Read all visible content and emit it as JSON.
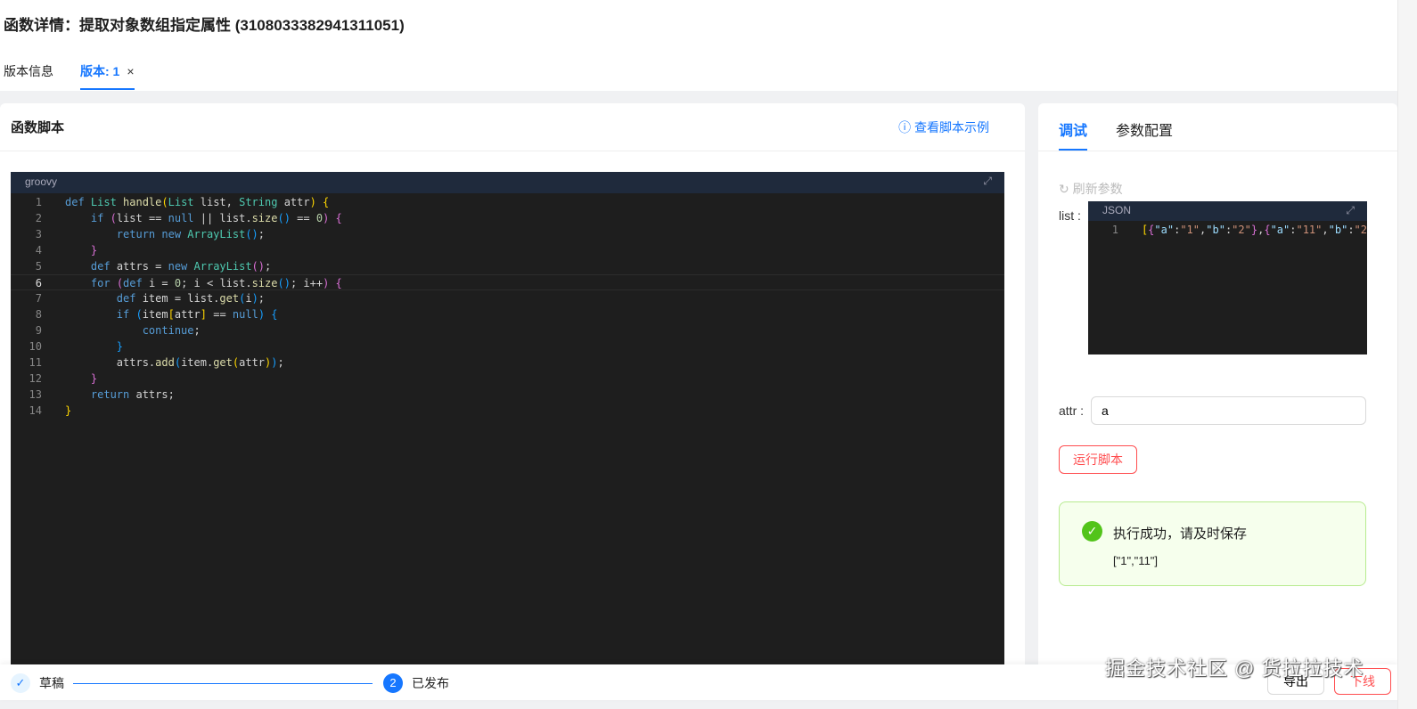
{
  "header": {
    "title": "函数详情：提取对象数组指定属性 (3108033382941311051)",
    "tabs": [
      "版本信息",
      "版本: 1"
    ],
    "close_icon": "×"
  },
  "script_panel": {
    "title": "函数脚本",
    "example_link": "查看脚本示例",
    "language": "groovy",
    "expand_icon": "⤢",
    "code": [
      [
        [
          "kw",
          "def "
        ],
        [
          "ty",
          "List "
        ],
        [
          "fn",
          "handle"
        ],
        [
          "p1",
          "("
        ],
        [
          "ty",
          "List "
        ],
        [
          "",
          "list, "
        ],
        [
          "ty",
          "String "
        ],
        [
          "",
          "attr"
        ],
        [
          "p1",
          ") {"
        ]
      ],
      [
        [
          "",
          "    "
        ],
        [
          "kw",
          "if "
        ],
        [
          "p2",
          "("
        ],
        [
          "",
          "list == "
        ],
        [
          "kw",
          "null"
        ],
        [
          "",
          " || list."
        ],
        [
          "fn",
          "size"
        ],
        [
          "p3",
          "()"
        ],
        [
          "",
          " == "
        ],
        [
          "num",
          "0"
        ],
        [
          "p2",
          ") {"
        ]
      ],
      [
        [
          "",
          "        "
        ],
        [
          "kw",
          "return new "
        ],
        [
          "ty",
          "ArrayList"
        ],
        [
          "p3",
          "()"
        ],
        [
          "",
          ";"
        ]
      ],
      [
        [
          "",
          "    "
        ],
        [
          "p2",
          "}"
        ]
      ],
      [
        [
          "",
          "    "
        ],
        [
          "kw",
          "def "
        ],
        [
          "",
          "attrs = "
        ],
        [
          "kw",
          "new "
        ],
        [
          "ty",
          "ArrayList"
        ],
        [
          "p2",
          "()"
        ],
        [
          "",
          ";"
        ]
      ],
      [
        [
          "",
          "    "
        ],
        [
          "kw",
          "for "
        ],
        [
          "p2",
          "("
        ],
        [
          "kw",
          "def "
        ],
        [
          "",
          "i = "
        ],
        [
          "num",
          "0"
        ],
        [
          "",
          "; i < list."
        ],
        [
          "fn",
          "size"
        ],
        [
          "p3",
          "()"
        ],
        [
          "",
          "; i++"
        ],
        [
          "p2",
          ") {"
        ]
      ],
      [
        [
          "",
          "        "
        ],
        [
          "kw",
          "def "
        ],
        [
          "",
          "item = list."
        ],
        [
          "fn",
          "get"
        ],
        [
          "p3",
          "("
        ],
        [
          "",
          "i"
        ],
        [
          "p3",
          ")"
        ],
        [
          "",
          ";"
        ]
      ],
      [
        [
          "",
          "        "
        ],
        [
          "kw",
          "if "
        ],
        [
          "p3",
          "("
        ],
        [
          "",
          "item"
        ],
        [
          "p1",
          "["
        ],
        [
          "",
          "attr"
        ],
        [
          "p1",
          "]"
        ],
        [
          "",
          " == "
        ],
        [
          "kw",
          "null"
        ],
        [
          "p3",
          ") {"
        ]
      ],
      [
        [
          "",
          "            "
        ],
        [
          "kw",
          "continue"
        ],
        [
          "",
          ";"
        ]
      ],
      [
        [
          "",
          "        "
        ],
        [
          "p3",
          "}"
        ]
      ],
      [
        [
          "",
          "        attrs."
        ],
        [
          "fn",
          "add"
        ],
        [
          "p3",
          "("
        ],
        [
          "",
          "item."
        ],
        [
          "fn",
          "get"
        ],
        [
          "p1",
          "("
        ],
        [
          "",
          "attr"
        ],
        [
          "p1",
          ")"
        ],
        [
          "p3",
          ")"
        ],
        [
          "",
          ";"
        ]
      ],
      [
        [
          "",
          "    "
        ],
        [
          "p2",
          "}"
        ]
      ],
      [
        [
          "",
          "    "
        ],
        [
          "kw",
          "return "
        ],
        [
          "",
          "attrs;"
        ]
      ],
      [
        [
          "p1",
          "}"
        ]
      ]
    ]
  },
  "debug_panel": {
    "tabs": [
      "调试",
      "参数配置"
    ],
    "refresh": "刷新参数",
    "list_label": "list :",
    "json_language": "JSON",
    "json_line": [
      [
        "p1",
        "["
      ],
      [
        "p2",
        "{"
      ],
      [
        "id",
        "\"a\""
      ],
      [
        "",
        ":"
      ],
      [
        "str",
        "\"1\""
      ],
      [
        "",
        ","
      ],
      [
        "id",
        "\"b\""
      ],
      [
        "",
        ":"
      ],
      [
        "str",
        "\"2\""
      ],
      [
        "p2",
        "}"
      ],
      [
        "",
        ","
      ],
      [
        "p2",
        "{"
      ],
      [
        "id",
        "\"a\""
      ],
      [
        "",
        ":"
      ],
      [
        "str",
        "\"11\""
      ],
      [
        "",
        ","
      ],
      [
        "id",
        "\"b\""
      ],
      [
        "",
        ":"
      ],
      [
        "str",
        "\"2"
      ]
    ],
    "attr_label": "attr :",
    "attr_value": "a",
    "run_button": "运行脚本",
    "result": {
      "message": "执行成功，请及时保存",
      "output": "[\"1\",\"11\"]"
    }
  },
  "footer": {
    "steps": [
      {
        "label": "草稿",
        "icon": "✓"
      },
      {
        "label": "已发布",
        "num": "2"
      }
    ],
    "export": "导出",
    "offline": "下线"
  },
  "watermark": "掘金技术社区 @ 货拉拉技术"
}
